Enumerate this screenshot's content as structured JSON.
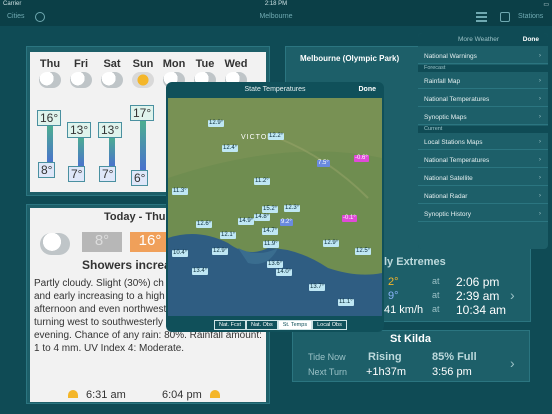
{
  "status_bar": {
    "carrier": "Carrier",
    "time": "2:18 PM"
  },
  "nav": {
    "cities": "Cities",
    "title": "Melbourne",
    "stations": "Stations"
  },
  "forecast": {
    "days": [
      "Thu",
      "Fri",
      "Sat",
      "Sun",
      "Mon",
      "Tue",
      "Wed"
    ],
    "highs": [
      "16°",
      "13°",
      "13°",
      "17°",
      "",
      "",
      ""
    ],
    "lows": [
      "8°",
      "7°",
      "7°",
      "6°",
      "",
      "",
      ""
    ]
  },
  "today": {
    "title": "Today - Thu",
    "min": "8°",
    "max": "16°",
    "summary": "Showers increas",
    "description": "Partly cloudy. Slight (30%) ch during the morning and early increasing to a high (80%) ch in the late afternoon and even northwesterly 20 to 25 km/h turning west to southwesterly 20 to 30 km/h this evening. Chance of any rain: 80%. Rainfall amount: 1 to 4 mm. UV Index 4: Moderate.",
    "sunrise": "6:31 am",
    "sunset": "6:04 pm"
  },
  "station": {
    "title": "Melbourne (Olympic Park)",
    "extremes_title": "ly Extremes",
    "rows": [
      {
        "value": "2°",
        "at": "at",
        "time": "2:06 pm"
      },
      {
        "value": "9°",
        "at": "at",
        "time": "2:39 am"
      },
      {
        "value": "41 km/h",
        "at": "at",
        "time": "10:34 am"
      }
    ]
  },
  "tide": {
    "title": "St Kilda",
    "label1": "Tide Now",
    "state": "Rising",
    "percent": "85% Full",
    "label2": "Next Turn",
    "duration": "+1h37m",
    "time": "3:56 pm"
  },
  "map_modal": {
    "title": "State Temperatures",
    "done": "Done",
    "region_label": "VICTORIA",
    "temps": [
      "12.9°",
      "12.2°",
      "12.4°",
      "7.5°",
      "-0.6°",
      "11.2°",
      "11.3°",
      "15.2°",
      "12.3°",
      "14.8°",
      "14.9°",
      "9.2°",
      "-0.1°",
      "12.6°",
      "12.1°",
      "14.7°",
      "12.9°",
      "11.9°",
      "12.9°",
      "12.5°",
      "10.4°",
      "13.6°",
      "13.4°",
      "14.0°",
      "13.7°",
      "11.1°"
    ],
    "tabs": [
      "Nat. Fcst",
      "Nat. Obs",
      "St. Temps",
      "Local Obs"
    ],
    "active_tab": "St. Temps"
  },
  "dropdown": {
    "header": "More Weather",
    "done": "Done",
    "items_top": [
      "National Warnings"
    ],
    "section_forecast": "Forecast",
    "items_forecast": [
      "Rainfall Map",
      "National Temperatures",
      "Synoptic Maps"
    ],
    "section_current": "Current",
    "items_current": [
      "Local Stations Maps",
      "National Temperatures",
      "National Satellite",
      "National Radar",
      "Synoptic History"
    ]
  },
  "colors": {
    "background": "#0f4b55",
    "panel": "#1d5f69",
    "accent": "#e04ad8"
  }
}
